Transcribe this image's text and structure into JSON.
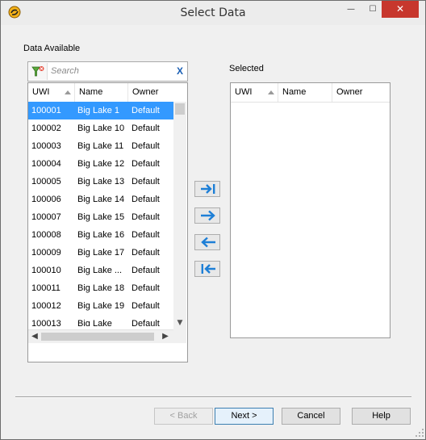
{
  "window": {
    "title": "Select Data",
    "minimize_glyph": "—",
    "maximize_glyph": "☐",
    "close_glyph": "✕"
  },
  "available": {
    "label": "Data Available",
    "search": {
      "placeholder": "Search",
      "value": "",
      "clear_label": "X"
    },
    "columns": [
      "UWI",
      "Name",
      "Owner"
    ],
    "rows": [
      {
        "uwi": "100001",
        "name": "Big Lake 1",
        "owner": "Default",
        "selected": true
      },
      {
        "uwi": "100002",
        "name": "Big Lake 10",
        "owner": "Default"
      },
      {
        "uwi": "100003",
        "name": "Big Lake 11",
        "owner": "Default"
      },
      {
        "uwi": "100004",
        "name": "Big Lake 12",
        "owner": "Default"
      },
      {
        "uwi": "100005",
        "name": "Big Lake 13",
        "owner": "Default"
      },
      {
        "uwi": "100006",
        "name": "Big Lake 14",
        "owner": "Default"
      },
      {
        "uwi": "100007",
        "name": "Big Lake 15",
        "owner": "Default"
      },
      {
        "uwi": "100008",
        "name": "Big Lake 16",
        "owner": "Default"
      },
      {
        "uwi": "100009",
        "name": "Big Lake 17",
        "owner": "Default"
      },
      {
        "uwi": "100010",
        "name": "Big Lake ...",
        "owner": "Default"
      },
      {
        "uwi": "100011",
        "name": "Big Lake 18",
        "owner": "Default"
      },
      {
        "uwi": "100012",
        "name": "Big Lake 19",
        "owner": "Default"
      },
      {
        "uwi": "100013",
        "name": "Big Lake",
        "owner": "Default"
      }
    ]
  },
  "selected": {
    "label": "Selected",
    "columns": [
      "UWI",
      "Name",
      "Owner"
    ],
    "rows": []
  },
  "move_buttons": [
    "move-all-right",
    "move-right",
    "move-left",
    "move-all-left"
  ],
  "buttons": {
    "back": "< Back",
    "next": "Next >",
    "cancel": "Cancel",
    "help": "Help"
  },
  "colors": {
    "selection": "#3399ff",
    "arrow": "#1e7fd6",
    "close": "#c7372d",
    "clear_x": "#1a5fb4"
  }
}
